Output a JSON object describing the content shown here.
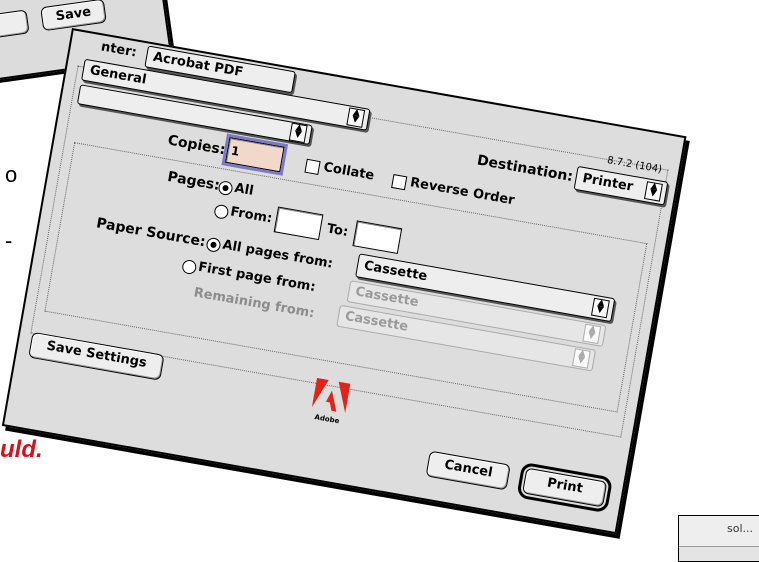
{
  "save_dialog": {
    "save_label": "Save"
  },
  "background": {
    "frag_o": "o",
    "frag_dash": "-",
    "frag_red": "uld.",
    "frag_corner": "sol..."
  },
  "print_dialog": {
    "printer_label": "nter:",
    "printer_value": "Acrobat PDF",
    "version": "8.7.2 (104)",
    "panel_value": "General",
    "copies_label": "Copies:",
    "copies_value": "1",
    "collate_label": "Collate",
    "reverse_label": "Reverse Order",
    "destination_label": "Destination:",
    "destination_value": "Printer",
    "pages_label": "Pages:",
    "pages_all_label": "All",
    "pages_from_label": "From:",
    "pages_to_label": "To:",
    "pages_from_value": "",
    "pages_to_value": "",
    "paper_source_label": "Paper Source:",
    "all_pages_from_label": "All pages from:",
    "first_page_from_label": "First page from:",
    "remaining_from_label": "Remaining from:",
    "all_pages_source": "Cassette",
    "first_page_source": "Cassette",
    "remaining_source": "Cassette",
    "save_settings_label": "Save Settings",
    "logo_text": "Adobe",
    "cancel_label": "Cancel",
    "print_label": "Print"
  },
  "colors": {
    "dialog_bg": "#dddddd",
    "focus_ring": "#7a7ac9",
    "copies_field_bg": "#f2d8c9",
    "adobe_red": "#e2231a",
    "red_text": "#d4111c"
  }
}
